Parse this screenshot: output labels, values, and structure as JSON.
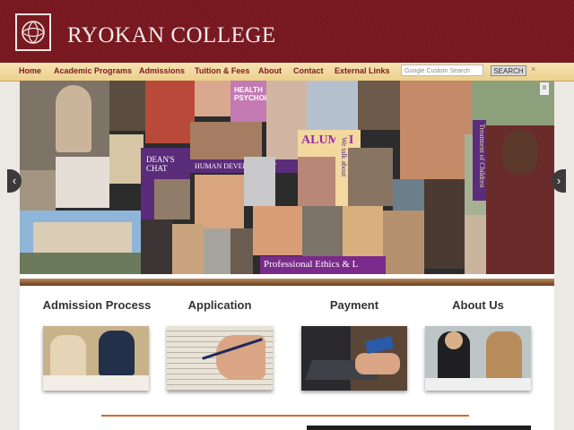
{
  "site": {
    "title": "RYOKAN COLLEGE"
  },
  "nav": {
    "items": [
      {
        "label": "Home"
      },
      {
        "label": "Academic Programs"
      },
      {
        "label": "Admissions"
      },
      {
        "label": "Tuition & Fees"
      },
      {
        "label": "About"
      },
      {
        "label": "Contact"
      },
      {
        "label": "External Links"
      }
    ]
  },
  "search": {
    "placeholder": "Google Custom Search",
    "button_label": "SEARCH",
    "clear_label": "×"
  },
  "hero": {
    "label_health": "HEALTH PSYCHOLOGY",
    "label_deans_chat": "DEAN'S CHAT",
    "label_human_development": "HUMAN DEVELOPMENT",
    "label_alumni": "ALUMNI",
    "label_we_talk_about": "We talk about",
    "label_treatment": "Treatment of Children",
    "label_professional_ethics": "Professional Ethics & L",
    "prev_label": "‹",
    "next_label": "›"
  },
  "sections": [
    {
      "title": "Admission Process"
    },
    {
      "title": "Application"
    },
    {
      "title": "Payment"
    },
    {
      "title": "About Us"
    }
  ],
  "colors": {
    "brand": "#7d1a22",
    "nav_bg": "#f2dca0",
    "accent_orange": "#d26a2c"
  }
}
